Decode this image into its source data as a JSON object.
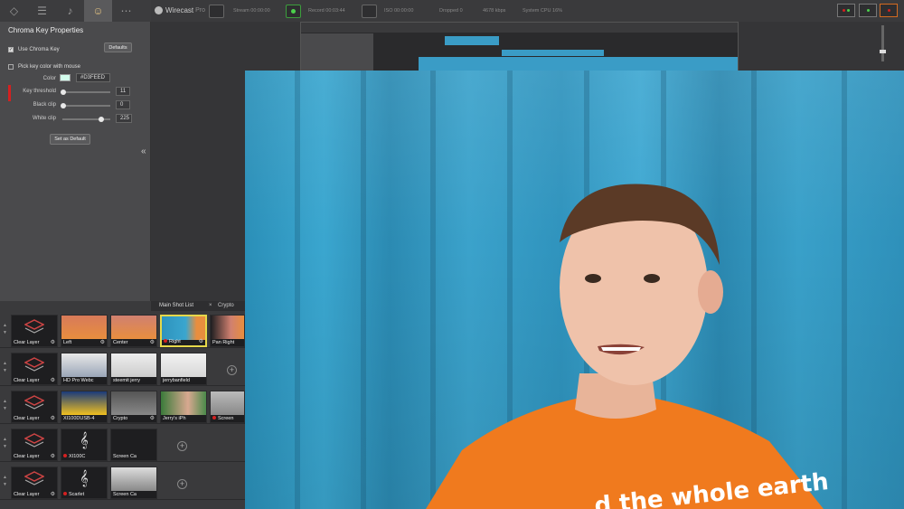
{
  "app": {
    "name": "Wirecast",
    "edition": "Pro"
  },
  "panel_tabs": [
    {
      "icon": "layers-icon"
    },
    {
      "icon": "sliders-icon"
    },
    {
      "icon": "audio-icon"
    },
    {
      "icon": "chroma-key-icon"
    },
    {
      "icon": "more-icon"
    }
  ],
  "chroma": {
    "title": "Chroma Key Properties",
    "use_chroma_key": "Use Chroma Key",
    "defaults_label": "Defaults",
    "pick_key_color": "Pick key color with mouse",
    "color_label": "Color",
    "color_value": "#D3FEED",
    "key_threshold_label": "Key threshold",
    "key_threshold_value": "11",
    "black_clip_label": "Black clip",
    "black_clip_value": "0",
    "white_clip_label": "White clip",
    "white_clip_value": "225",
    "set_default_label": "Set as Default"
  },
  "topbar": {
    "stream": "Stream 00:00:00",
    "record": "Record 00:03:44",
    "iso": "ISO 00:00:00",
    "dropped": "Dropped 0",
    "bitrate": "4678 kbps",
    "cpu": "System CPU 16%"
  },
  "shotlist": {
    "tab_main": "Main Shot List",
    "tab_other": "Crypto",
    "rows": [
      [
        "Clear Layer",
        "Left",
        "Center",
        "Right",
        "Pan Right"
      ],
      [
        "Clear Layer",
        "HD Pro Webc",
        "steemit jerry",
        "jerrybanfield"
      ],
      [
        "Clear Layer",
        "XI100DUSB-4",
        "Crypto",
        "Jerry's iPh",
        "Screen"
      ],
      [
        "Clear Layer",
        "XI100C",
        "Screen Ca"
      ],
      [
        "Clear Layer",
        "Scarlet",
        "Screen Ca"
      ]
    ]
  },
  "video": {
    "shirt_text": "…d the whole earth"
  }
}
